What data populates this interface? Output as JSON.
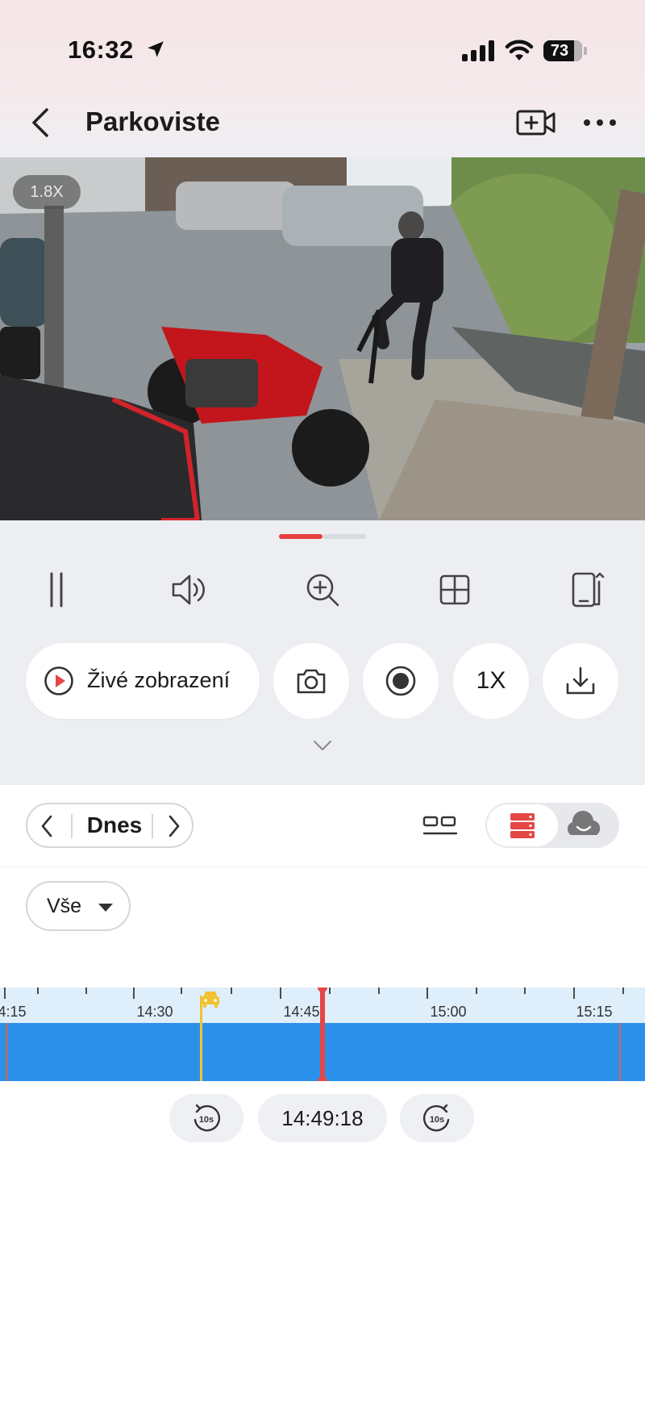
{
  "status_bar": {
    "time": "16:32",
    "battery": "73"
  },
  "header": {
    "title": "Parkoviste"
  },
  "video": {
    "zoom": "1.8X"
  },
  "toolbar": {
    "icons": [
      "pause-icon",
      "speaker-icon",
      "zoom-in-icon",
      "grid-view-icon",
      "rotate-screen-icon"
    ]
  },
  "actions": {
    "live_label": "Živé zobrazení",
    "speed_label": "1X"
  },
  "panel": {
    "date_label": "Dnes",
    "filter_label": "Vše"
  },
  "timeline": {
    "tick_labels": [
      "4:15",
      "14:30",
      "14:45",
      "15:00",
      "15:15"
    ],
    "current_time": "14:49:18"
  },
  "colors": {
    "accent_red": "#e54646",
    "recording_blue": "#2a90ea",
    "event_yellow": "#f2c230"
  }
}
